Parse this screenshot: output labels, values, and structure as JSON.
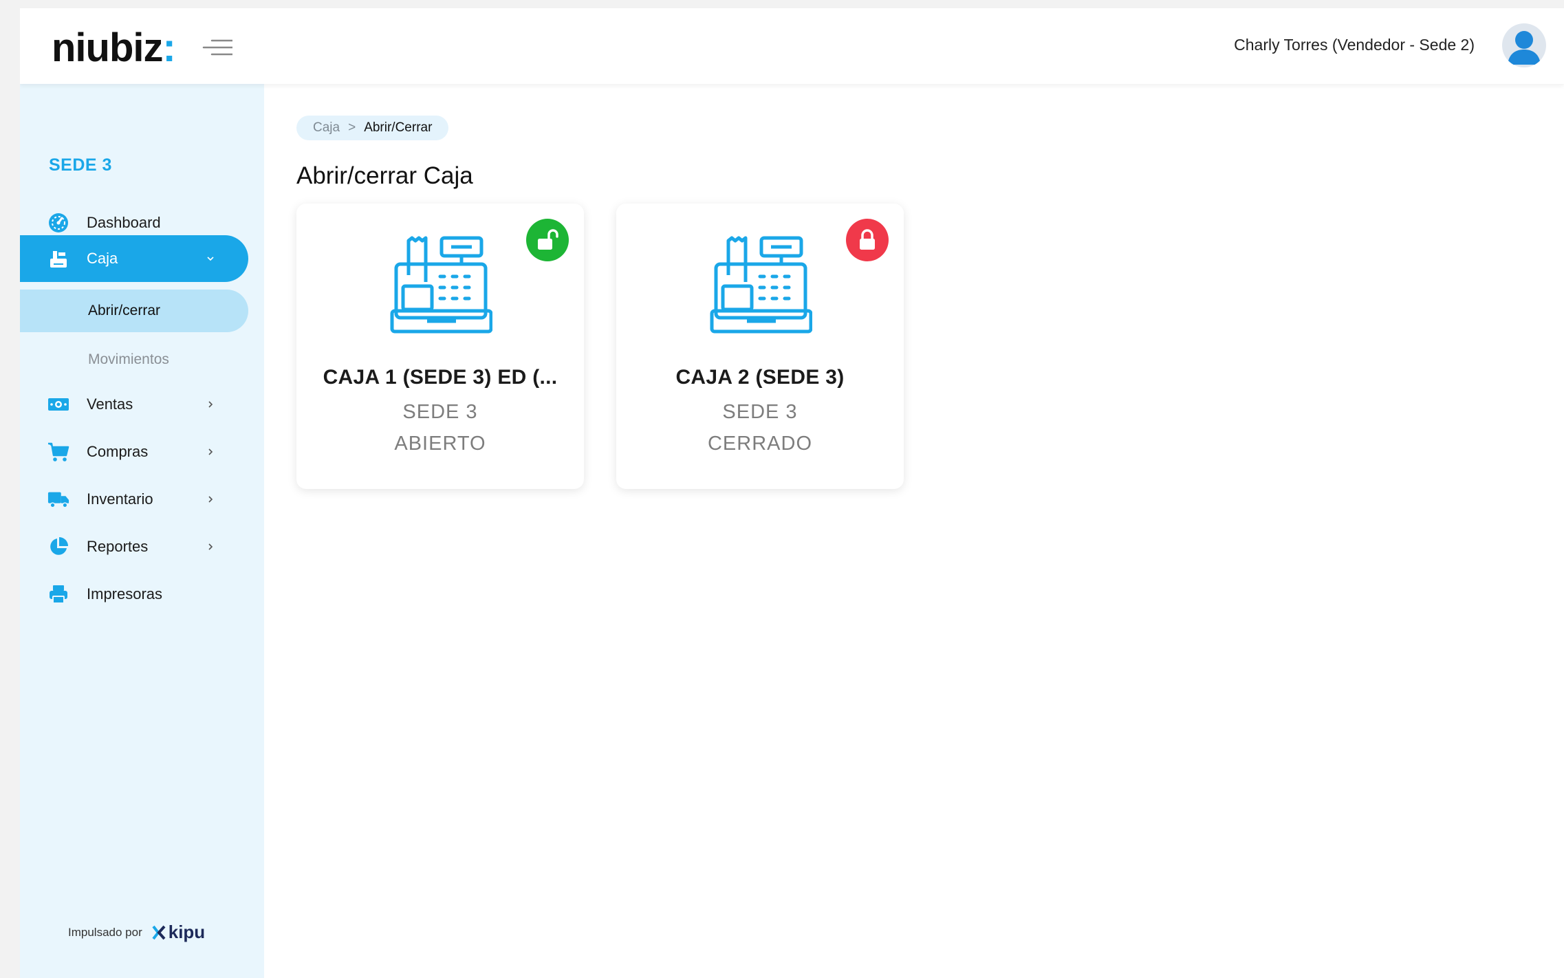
{
  "header": {
    "logo_text": "niubiz",
    "logo_colon": ":",
    "user_label": "Charly Torres (Vendedor - Sede 2)"
  },
  "sidebar": {
    "sede": "SEDE 3",
    "items": [
      {
        "label": "Dashboard",
        "icon": "dashboard-icon"
      },
      {
        "label": "Caja",
        "icon": "cash-register-icon"
      },
      {
        "label": "Ventas",
        "icon": "money-icon"
      },
      {
        "label": "Compras",
        "icon": "cart-icon"
      },
      {
        "label": "Inventario",
        "icon": "truck-icon"
      },
      {
        "label": "Reportes",
        "icon": "pie-chart-icon"
      },
      {
        "label": "Impresoras",
        "icon": "printer-icon"
      }
    ],
    "caja_sub": [
      {
        "label": "Abrir/cerrar"
      },
      {
        "label": "Movimientos"
      }
    ],
    "powered_by": "Impulsado por",
    "powered_brand": "kipu"
  },
  "breadcrumb": {
    "root": "Caja",
    "separator": ">",
    "current": "Abrir/Cerrar"
  },
  "page": {
    "title": "Abrir/cerrar Caja"
  },
  "cards": [
    {
      "name": "CAJA 1 (SEDE 3) ED (...",
      "sede": "SEDE 3",
      "status": "ABIERTO",
      "badge_color": "#1db535",
      "badge_icon": "unlocked-icon"
    },
    {
      "name": "CAJA 2 (SEDE 3)",
      "sede": "SEDE 3",
      "status": "CERRADO",
      "badge_color": "#f0394a",
      "badge_icon": "locked-icon"
    }
  ],
  "colors": {
    "accent": "#1aa7e8",
    "sidebar_bg": "#e9f6fd",
    "open": "#1db535",
    "closed": "#f0394a"
  }
}
